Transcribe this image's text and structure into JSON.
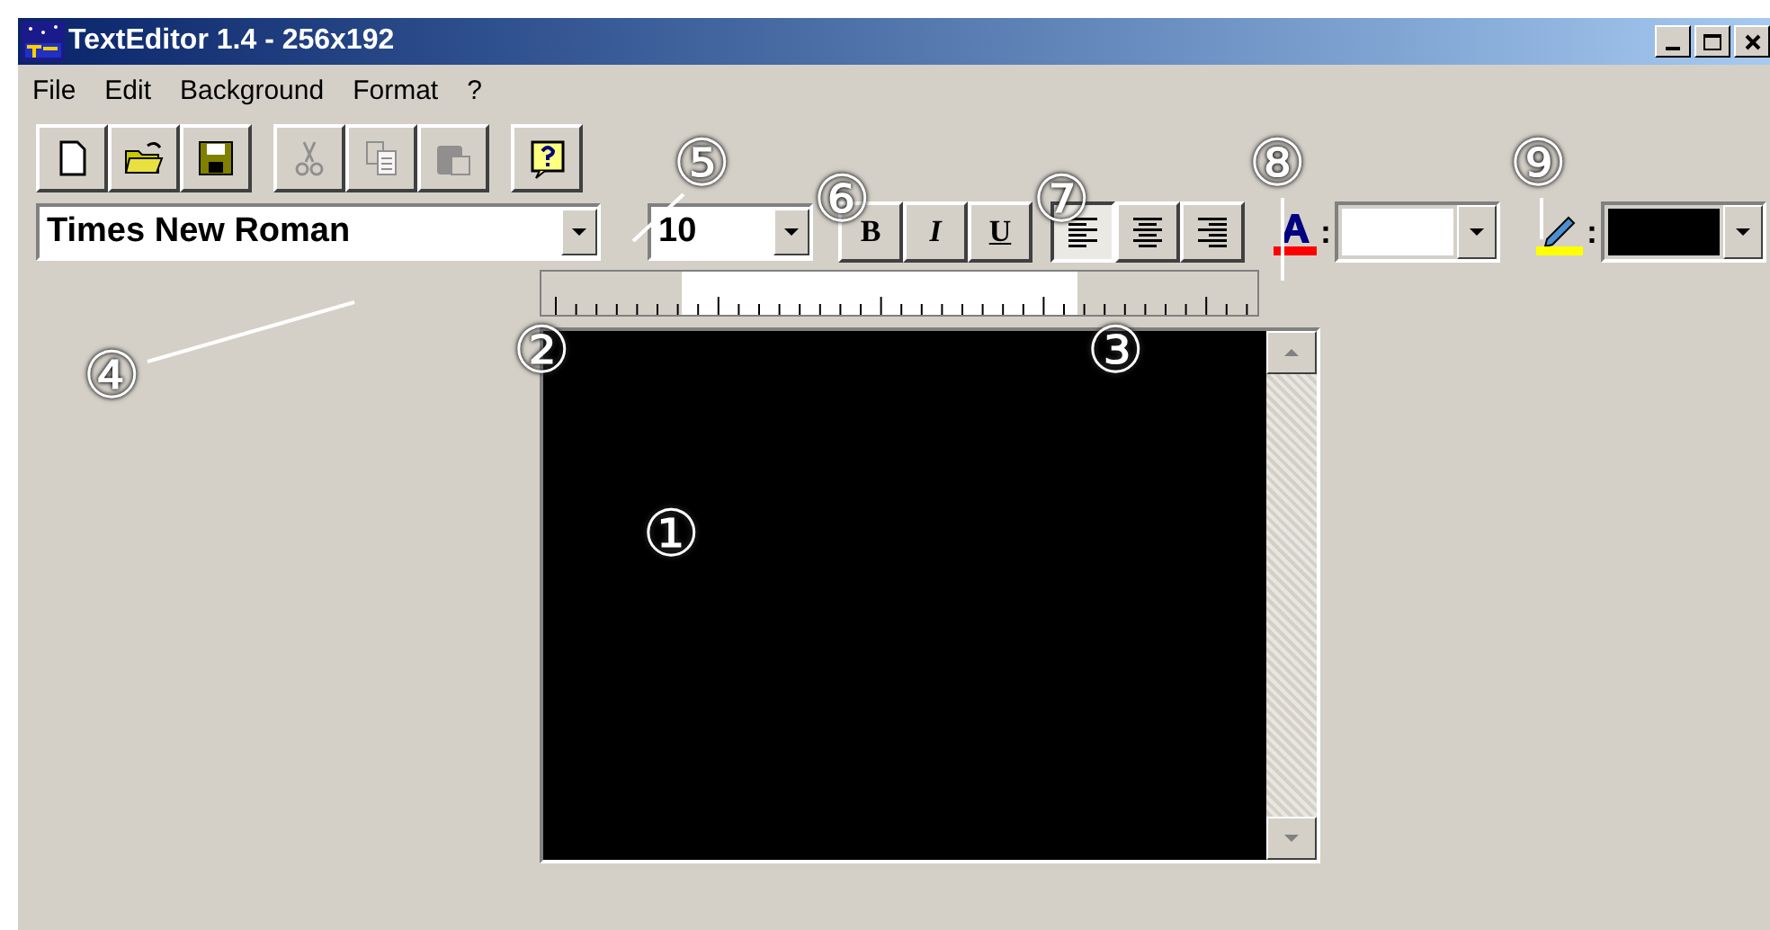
{
  "window": {
    "title": "TextEditor 1.4 - 256x192"
  },
  "menu": [
    "File",
    "Edit",
    "Background",
    "Format",
    "?"
  ],
  "toolbar": [
    {
      "kind": "new",
      "disabled": false
    },
    {
      "kind": "open",
      "disabled": false
    },
    {
      "kind": "save",
      "disabled": false
    },
    {
      "kind": "cut",
      "disabled": true
    },
    {
      "kind": "copy",
      "disabled": true
    },
    {
      "kind": "paste",
      "disabled": true
    },
    {
      "kind": "help",
      "disabled": false
    }
  ],
  "font": {
    "value": "Times New Roman"
  },
  "size": {
    "value": "10"
  },
  "style_buttons": [
    {
      "label": "B",
      "kind": "bold"
    },
    {
      "label": "I",
      "kind": "italic"
    },
    {
      "label": "U",
      "kind": "underline"
    }
  ],
  "align_buttons": [
    {
      "kind": "left",
      "selected": true
    },
    {
      "kind": "center",
      "selected": false
    },
    {
      "kind": "right",
      "selected": false
    }
  ],
  "text_color": {
    "color": "#ffffff",
    "separator": ":"
  },
  "background_color": {
    "color": "#000000",
    "separator": ":"
  },
  "callouts": [
    "①",
    "②",
    "③",
    "④",
    "⑤",
    "⑥",
    "⑦",
    "⑧",
    "⑨"
  ]
}
